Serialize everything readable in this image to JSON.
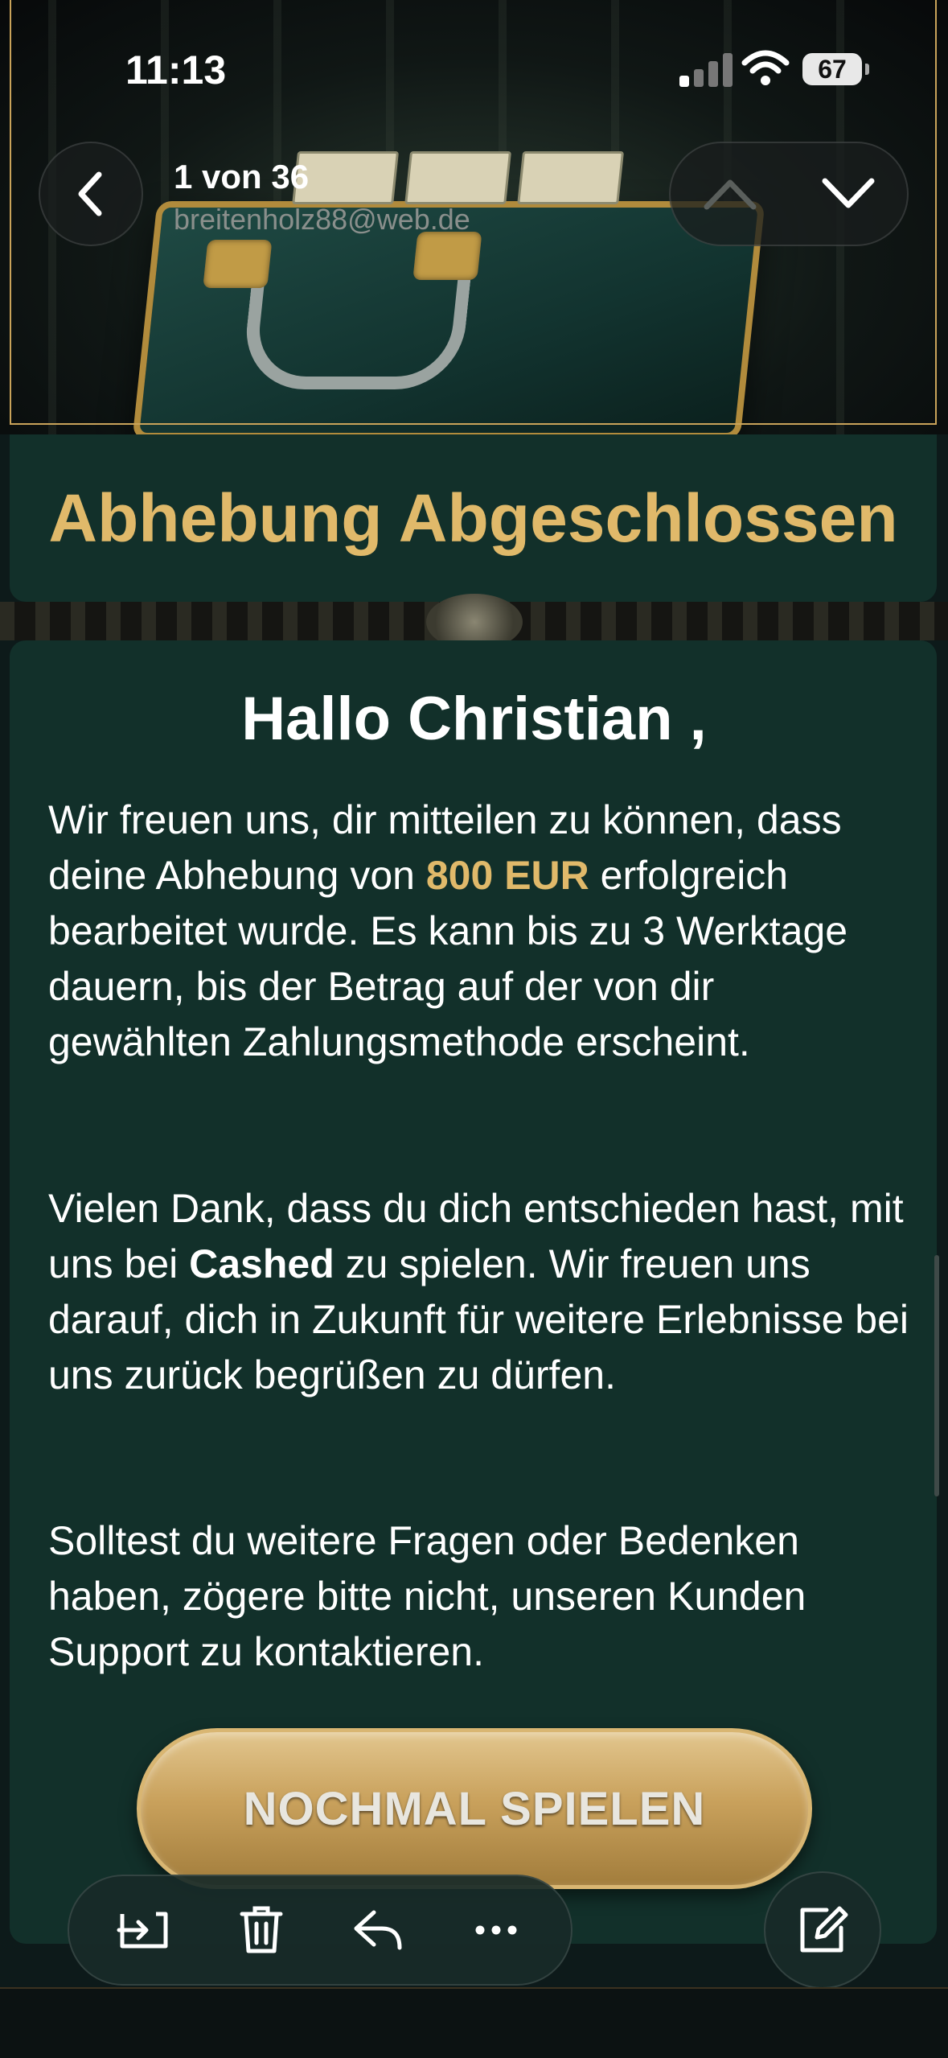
{
  "status_bar": {
    "time": "11:13",
    "battery": "67"
  },
  "mail_nav": {
    "position": "1 von 36",
    "sender": "breitenholz88@web.de",
    "icons": [
      "chevron-left-icon",
      "chevron-up-icon",
      "chevron-down-icon"
    ]
  },
  "email": {
    "title": "Abhebung Abgeschlossen",
    "greeting": "Hallo Christian ,",
    "para1_a": "Wir freuen uns, dir mitteilen zu können, dass deine Abhebung von ",
    "para1_amount": "800 EUR",
    "para1_b": " erfolgreich bearbeitet wurde. Es kann bis zu 3 Werktage dauern, bis der Betrag auf der von dir gewählten Zahlungsmethode erscheint.",
    "para2_a": "Vielen Dank, dass du dich entschieden hast, mit uns bei ",
    "para2_brand": "Cashed",
    "para2_b": " zu spielen. Wir freuen uns darauf, dich in Zukunft für weitere Erlebnisse bei uns zurück begrüßen zu dürfen.",
    "para3": "Solltest du weitere Fragen oder Bedenken haben, zögere bitte nicht, unseren Kunden Support zu kontaktieren.",
    "cta_label": "NOCHMAL SPIELEN"
  },
  "toolbar": {
    "icons": [
      "move-to-folder-icon",
      "trash-icon",
      "reply-icon",
      "more-icon",
      "compose-icon"
    ]
  },
  "colors": {
    "gold": "#e0b96a",
    "card_bg": "#12302a",
    "page_bg": "#0d1a1a"
  }
}
